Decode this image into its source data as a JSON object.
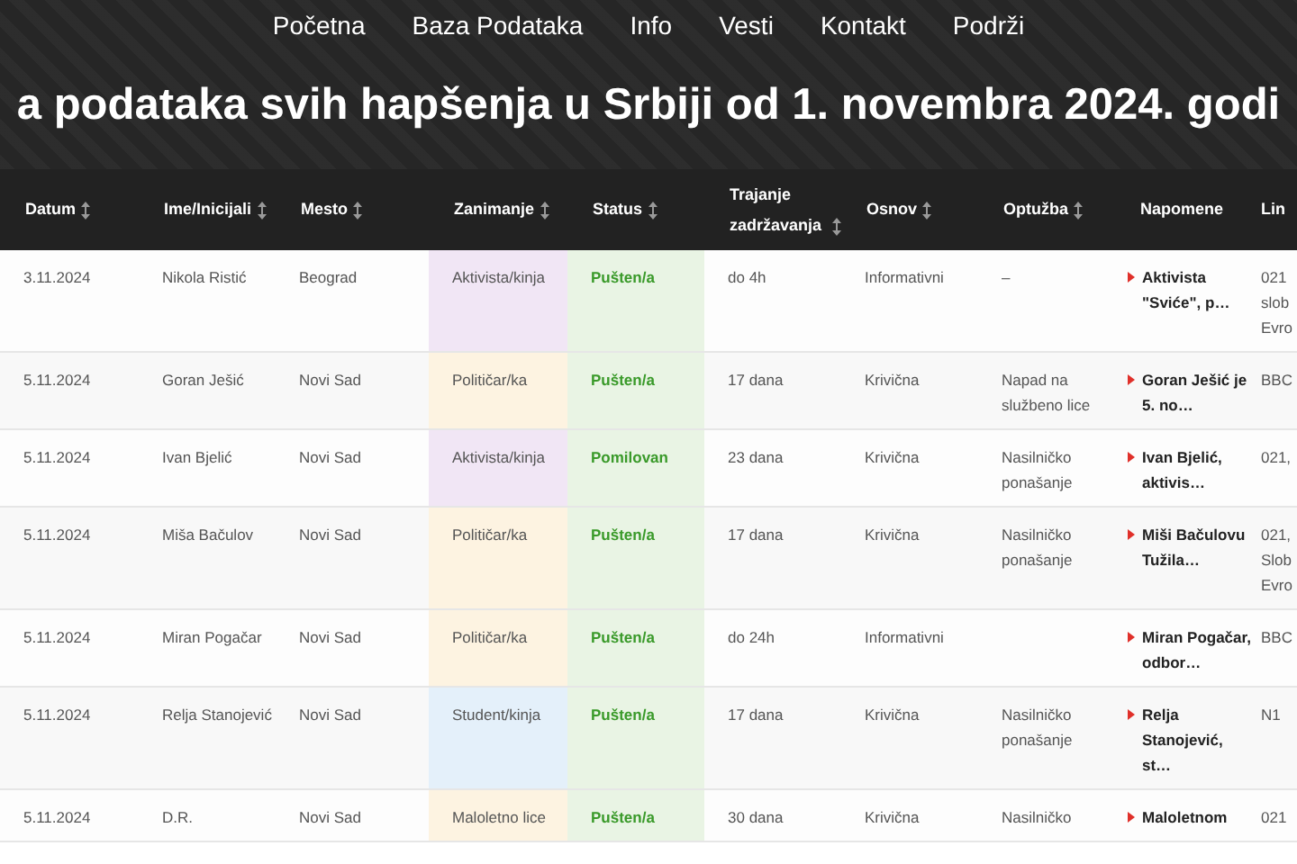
{
  "nav": {
    "items": [
      {
        "label": "Početna"
      },
      {
        "label": "Baza Podataka"
      },
      {
        "label": "Info"
      },
      {
        "label": "Vesti"
      },
      {
        "label": "Kontakt"
      },
      {
        "label": "Podrži"
      }
    ]
  },
  "title": "a podataka svih hapšenja u Srbiji od 1. novembra 2024. godi",
  "table": {
    "columns": [
      {
        "label": "Datum",
        "sortable": true
      },
      {
        "label": "Ime/Inicijali",
        "sortable": true
      },
      {
        "label": "Mesto",
        "sortable": true
      },
      {
        "label": "Zanimanje",
        "sortable": true
      },
      {
        "label": "Status",
        "sortable": true
      },
      {
        "label": "Trajanje zadržavanja",
        "sortable": true
      },
      {
        "label": "Osnov",
        "sortable": true
      },
      {
        "label": "Optužba",
        "sortable": true
      },
      {
        "label": "Napomene",
        "sortable": false
      },
      {
        "label": "Lin",
        "sortable": false
      }
    ],
    "rows": [
      {
        "date": "3.11.2024",
        "name": "Nikola Ristić",
        "place": "Beograd",
        "occupation": {
          "text": "Aktivista/kinja",
          "color": "#f1e6f5"
        },
        "status": "Pušten/a",
        "duration": "do 4h",
        "basis": "Informativni",
        "charge": "–",
        "note": "Aktivista \"Sviće\", p…",
        "link": "021 slob Evro"
      },
      {
        "date": "5.11.2024",
        "name": "Goran Ješić",
        "place": "Novi Sad",
        "occupation": {
          "text": "Političar/ka",
          "color": "#fdf3e1"
        },
        "status": "Pušten/a",
        "duration": "17 dana",
        "basis": "Krivična",
        "charge": "Napad na službeno lice",
        "note": "Goran Ješić je 5. no…",
        "link": "BBC"
      },
      {
        "date": "5.11.2024",
        "name": "Ivan Bjelić",
        "place": "Novi Sad",
        "occupation": {
          "text": "Aktivista/kinja",
          "color": "#f1e6f5"
        },
        "status": "Pomilovan",
        "duration": "23 dana",
        "basis": "Krivična",
        "charge": "Nasilničko ponašanje",
        "note": "Ivan Bjelić, aktivis…",
        "link": "021,"
      },
      {
        "date": "5.11.2024",
        "name": "Miša Bačulov",
        "place": "Novi Sad",
        "occupation": {
          "text": "Političar/ka",
          "color": "#fdf3e1"
        },
        "status": "Pušten/a",
        "duration": "17 dana",
        "basis": "Krivična",
        "charge": "Nasilničko ponašanje",
        "note": "Miši Bačulovu Tužila…",
        "link": "021, Slob Evro"
      },
      {
        "date": "5.11.2024",
        "name": "Miran Pogačar",
        "place": "Novi Sad",
        "occupation": {
          "text": "Političar/ka",
          "color": "#fdf3e1"
        },
        "status": "Pušten/a",
        "duration": "do 24h",
        "basis": "Informativni",
        "note": "Miran Pogačar, odbor…",
        "link": "BBC"
      },
      {
        "date": "5.11.2024",
        "name": "Relja Stanojević",
        "place": "Novi Sad",
        "occupation": {
          "text": "Student/kinja",
          "color": "#e4f0fa"
        },
        "status": "Pušten/a",
        "duration": "17 dana",
        "basis": "Krivična",
        "charge": "Nasilničko ponašanje",
        "note": "Relja Stanojević, st…",
        "link": "N1"
      },
      {
        "date": "5.11.2024",
        "name": "D.R.",
        "place": "Novi Sad",
        "occupation": {
          "text": "Maloletno lice",
          "color": "#fdf3e1"
        },
        "status": "Pušten/a",
        "duration": "30 dana",
        "basis": "Krivična",
        "charge": "Nasilničko",
        "note": "Maloletnom",
        "link": "021"
      }
    ]
  }
}
